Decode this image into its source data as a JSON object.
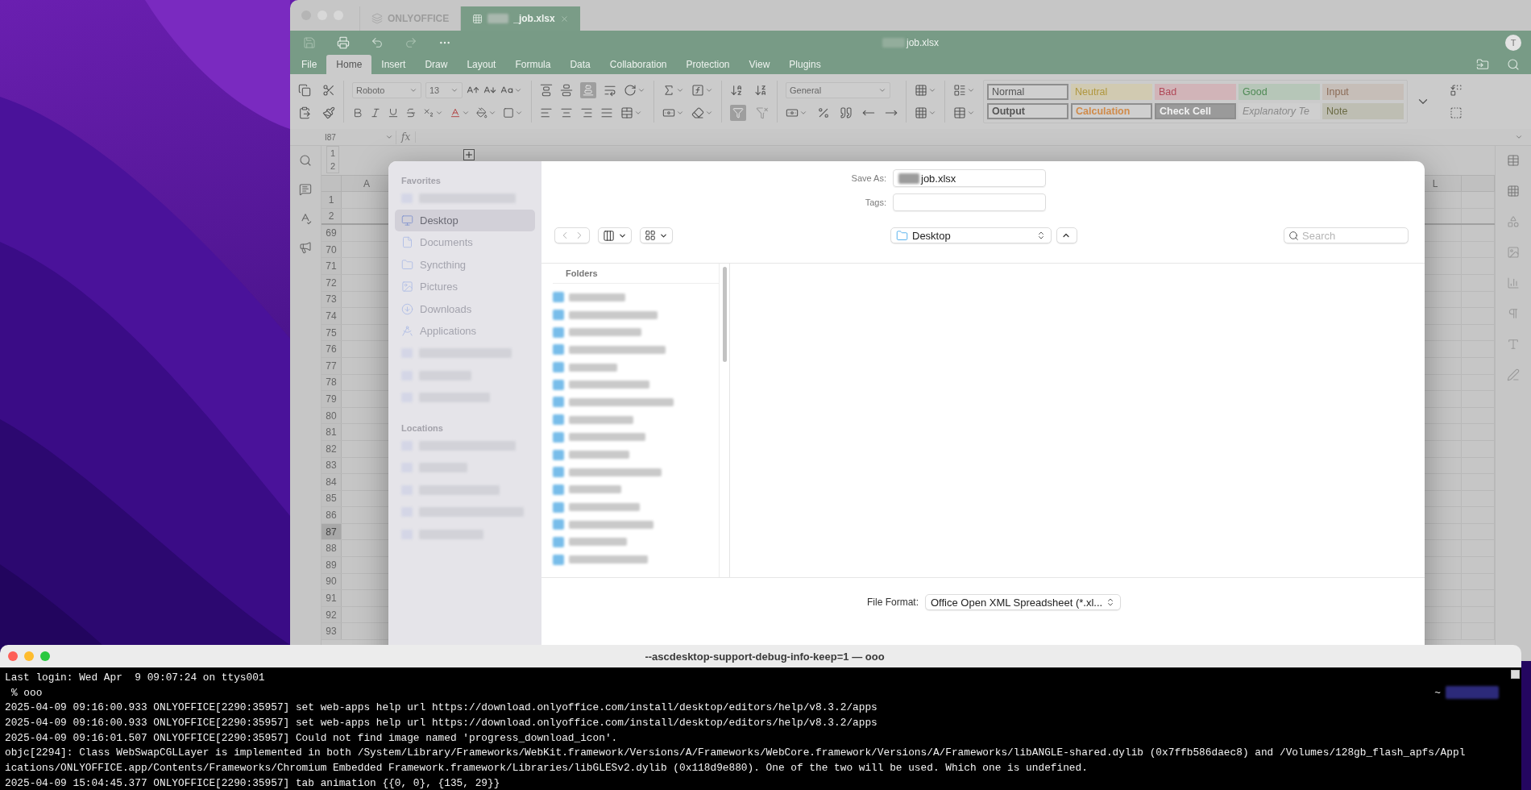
{
  "office": {
    "tabs": [
      {
        "label": "ONLYOFFICE",
        "selected": false,
        "redacted": false
      },
      {
        "label": "_job.xlsx",
        "selected": true,
        "redacted": true
      }
    ],
    "title": {
      "text": "job.xlsx",
      "redacted": true
    },
    "avatar": "T",
    "menu": [
      {
        "label": "File",
        "selected": false
      },
      {
        "label": "Home",
        "selected": true
      },
      {
        "label": "Insert",
        "selected": false
      },
      {
        "label": "Draw",
        "selected": false
      },
      {
        "label": "Layout",
        "selected": false
      },
      {
        "label": "Formula",
        "selected": false
      },
      {
        "label": "Data",
        "selected": false
      },
      {
        "label": "Collaboration",
        "selected": false
      },
      {
        "label": "Protection",
        "selected": false
      },
      {
        "label": "View",
        "selected": false
      },
      {
        "label": "Plugins",
        "selected": false
      }
    ],
    "font": "Roboto",
    "font_size": "13",
    "number_format": "General",
    "cell_styles": [
      {
        "label": "Normal",
        "kind": "bordered",
        "color": "#555555"
      },
      {
        "label": "Neutral",
        "kind": "tinted",
        "color": "#b0973e"
      },
      {
        "label": "Bad",
        "kind": "tinted",
        "color": "#b04858"
      },
      {
        "label": "Good",
        "kind": "tinted",
        "color": "#4f8a55"
      },
      {
        "label": "Input",
        "kind": "tinted",
        "color": "#8a6a55"
      },
      {
        "label": "Output",
        "kind": "bold",
        "color": "#555555"
      },
      {
        "label": "Calculation",
        "kind": "bold",
        "color": "#d08b4a"
      },
      {
        "label": "Check Cell",
        "kind": "inverse",
        "color": "#9a9a9a"
      },
      {
        "label": "Explanatory Te",
        "kind": "italic",
        "color": "#8a8a8a"
      },
      {
        "label": "Note",
        "kind": "tinted",
        "color": "#6b6b45"
      }
    ],
    "name_box": "I87",
    "formula_label": "fx",
    "outline_levels": [
      "1",
      "2"
    ],
    "columns": [
      "A",
      "L"
    ],
    "rows": [
      {
        "label": "1",
        "selected": false
      },
      {
        "label": "2",
        "selected": false
      },
      {
        "label": "69",
        "selected": false
      },
      {
        "label": "70",
        "selected": false
      },
      {
        "label": "71",
        "selected": false
      },
      {
        "label": "72",
        "selected": false
      },
      {
        "label": "73",
        "selected": false
      },
      {
        "label": "74",
        "selected": false
      },
      {
        "label": "75",
        "selected": false
      },
      {
        "label": "76",
        "selected": false
      },
      {
        "label": "77",
        "selected": false
      },
      {
        "label": "78",
        "selected": false
      },
      {
        "label": "79",
        "selected": false
      },
      {
        "label": "80",
        "selected": false
      },
      {
        "label": "81",
        "selected": false
      },
      {
        "label": "82",
        "selected": false
      },
      {
        "label": "83",
        "selected": false
      },
      {
        "label": "84",
        "selected": false
      },
      {
        "label": "85",
        "selected": false
      },
      {
        "label": "86",
        "selected": false
      },
      {
        "label": "87",
        "selected": true
      },
      {
        "label": "88",
        "selected": false
      },
      {
        "label": "89",
        "selected": false
      },
      {
        "label": "90",
        "selected": false
      },
      {
        "label": "91",
        "selected": false
      },
      {
        "label": "92",
        "selected": false
      },
      {
        "label": "93",
        "selected": false
      }
    ]
  },
  "save_dialog": {
    "favorites_heading": "Favorites",
    "favorites": [
      {
        "kind": "redacted",
        "selected": false
      },
      {
        "kind": "place",
        "label": "Desktop",
        "selected": true
      },
      {
        "kind": "place",
        "label": "Documents",
        "selected": false
      },
      {
        "kind": "place",
        "label": "Syncthing",
        "selected": false
      },
      {
        "kind": "place",
        "label": "Pictures",
        "selected": false
      },
      {
        "kind": "place",
        "label": "Downloads",
        "selected": false
      },
      {
        "kind": "place",
        "label": "Applications",
        "selected": false
      },
      {
        "kind": "redacted",
        "selected": false
      },
      {
        "kind": "redacted",
        "selected": false
      },
      {
        "kind": "redacted",
        "selected": false
      }
    ],
    "locations_heading": "Locations",
    "locations": [
      {
        "kind": "redacted",
        "selected": false
      },
      {
        "kind": "redacted",
        "selected": false
      },
      {
        "kind": "redacted",
        "selected": false
      },
      {
        "kind": "redacted",
        "selected": false
      },
      {
        "kind": "redacted",
        "selected": false
      }
    ],
    "save_as_label": "Save As:",
    "save_as": {
      "value": "job.xlsx",
      "redacted": true
    },
    "tags_label": "Tags:",
    "location": "Desktop",
    "search": {
      "placeholder": "Search"
    },
    "folders_heading": "Folders",
    "folders": [
      {
        "kind": "redacted"
      },
      {
        "kind": "redacted"
      },
      {
        "kind": "redacted"
      },
      {
        "kind": "redacted"
      },
      {
        "kind": "redacted"
      },
      {
        "kind": "redacted"
      },
      {
        "kind": "redacted"
      },
      {
        "kind": "redacted"
      },
      {
        "kind": "redacted"
      },
      {
        "kind": "redacted"
      },
      {
        "kind": "redacted"
      },
      {
        "kind": "redacted"
      },
      {
        "kind": "redacted"
      },
      {
        "kind": "redacted"
      },
      {
        "kind": "redacted"
      },
      {
        "kind": "redacted"
      }
    ],
    "file_format_label": "File Format:",
    "file_format": "Office Open XML Spreadsheet (*.xl..."
  },
  "terminal": {
    "title": "--ascdesktop-support-debug-info-keep=1 — ooo",
    "lines": [
      {
        "kind": "output",
        "text": "Last login: Wed Apr  9 09:07:24 on ttys001"
      },
      {
        "kind": "prompt",
        "text": "% ooo",
        "right": "~"
      },
      {
        "kind": "output",
        "text": "2025-04-09 09:16:00.933 ONLYOFFICE[2290:35957] set web-apps help url https://download.onlyoffice.com/install/desktop/editors/help/v8.3.2/apps"
      },
      {
        "kind": "output",
        "text": "2025-04-09 09:16:00.933 ONLYOFFICE[2290:35957] set web-apps help url https://download.onlyoffice.com/install/desktop/editors/help/v8.3.2/apps"
      },
      {
        "kind": "output",
        "text": "2025-04-09 09:16:01.507 ONLYOFFICE[2290:35957] Could not find image named 'progress_download_icon'."
      },
      {
        "kind": "output",
        "text": "objc[2294]: Class WebSwapCGLLayer is implemented in both /System/Library/Frameworks/WebKit.framework/Versions/A/Frameworks/WebCore.framework/Versions/A/Frameworks/libANGLE-shared.dylib (0x7ffb586daec8) and /Volumes/128gb_flash_apfs/Appl"
      },
      {
        "kind": "output",
        "text": "ications/ONLYOFFICE.app/Contents/Frameworks/Chromium Embedded Framework.framework/Libraries/libGLESv2.dylib (0x118d9e880). One of the two will be used. Which one is undefined."
      },
      {
        "kind": "output",
        "text": "2025-04-09 15:04:45.377 ONLYOFFICE[2290:35957] tab animation {{0, 0}, {135, 29}}"
      }
    ]
  }
}
